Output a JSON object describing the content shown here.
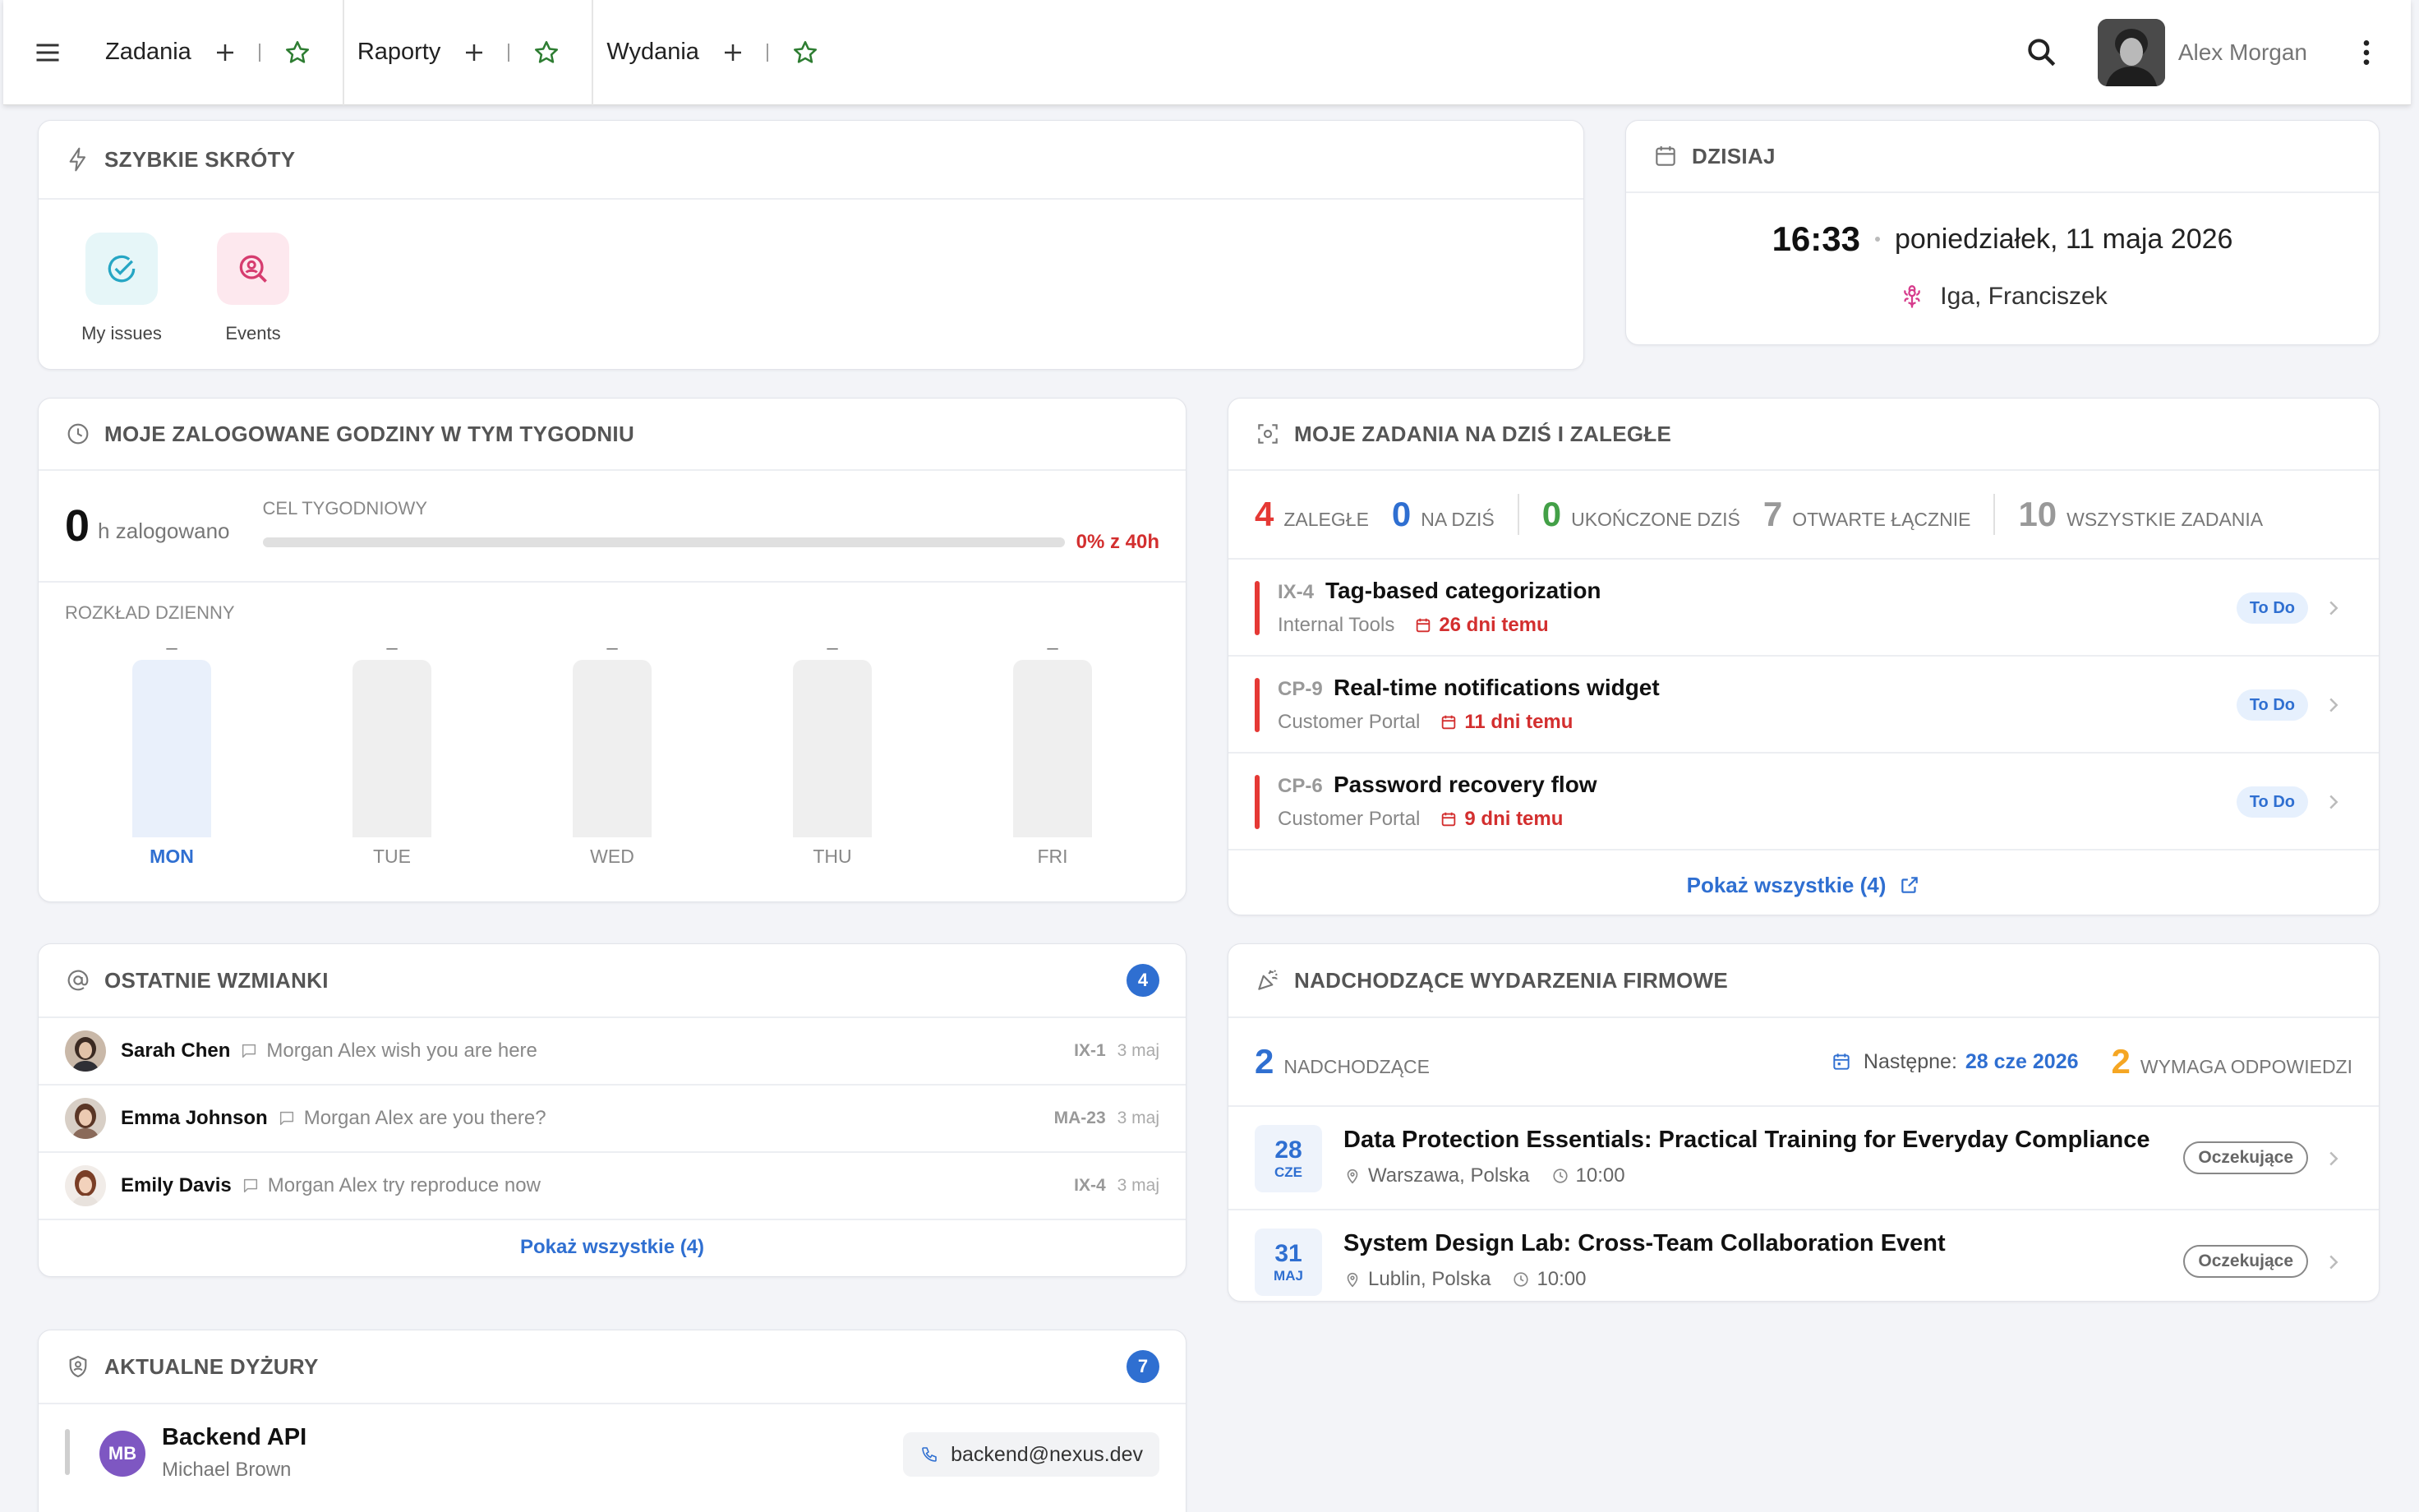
{
  "topbar": {
    "tabs": [
      {
        "label": "Zadania"
      },
      {
        "label": "Raporty"
      },
      {
        "label": "Wydania"
      }
    ],
    "user_name": "Alex Morgan"
  },
  "shortcuts": {
    "title": "SZYBKIE SKRÓTY",
    "items": [
      {
        "label": "My issues",
        "icon": "check-circle-icon",
        "bg": "#e6f6f8",
        "color": "#26a6c4"
      },
      {
        "label": "Events",
        "icon": "search-person-icon",
        "bg": "#fde8ee",
        "color": "#d63c6f"
      }
    ]
  },
  "today": {
    "title": "DZISIAJ",
    "time": "16:33",
    "date": "poniedziałek, 11 maja 2026",
    "nameday": "Iga, Franciszek"
  },
  "hours": {
    "title": "MOJE ZALOGOWANE GODZINY W TYM TYGODNIU",
    "logged": "0",
    "logged_unit": "h zalogowano",
    "goal_label": "CEL TYGODNIOWY",
    "goal_pct_text": "0% z 40h",
    "goal_fraction": 0,
    "daily_label": "ROZKŁAD DZIENNY",
    "days": [
      {
        "day": "MON",
        "value": "–",
        "active": true
      },
      {
        "day": "TUE",
        "value": "–",
        "active": false
      },
      {
        "day": "WED",
        "value": "–",
        "active": false
      },
      {
        "day": "THU",
        "value": "–",
        "active": false
      },
      {
        "day": "FRI",
        "value": "–",
        "active": false
      }
    ]
  },
  "tasks": {
    "title": "MOJE ZADANIA NA DZIŚ I ZALEGŁE",
    "stats": [
      {
        "num": "4",
        "label": "ZALEGŁE",
        "color": "#e53935"
      },
      {
        "num": "0",
        "label": "NA DZIŚ",
        "color": "#2f6fd1"
      },
      {
        "num": "0",
        "label": "UKOŃCZONE DZIŚ",
        "color": "#43a047"
      },
      {
        "num": "7",
        "label": "OTWARTE ŁĄCZNIE",
        "color": "#999999"
      },
      {
        "num": "10",
        "label": "WSZYSTKIE ZADANIA",
        "color": "#999999"
      }
    ],
    "items": [
      {
        "key": "IX-4",
        "title": "Tag-based categorization",
        "project": "Internal Tools",
        "due": "26 dni temu",
        "status": "To Do"
      },
      {
        "key": "CP-9",
        "title": "Real-time notifications widget",
        "project": "Customer Portal",
        "due": "11 dni temu",
        "status": "To Do"
      },
      {
        "key": "CP-6",
        "title": "Password recovery flow",
        "project": "Customer Portal",
        "due": "9 dni temu",
        "status": "To Do"
      }
    ],
    "show_all": "Pokaż wszystkie (4)"
  },
  "mentions": {
    "title": "OSTATNIE WZMIANKI",
    "count": "4",
    "items": [
      {
        "name": "Sarah Chen",
        "text": "Morgan Alex wish you are here",
        "key": "IX-1",
        "date": "3 maj"
      },
      {
        "name": "Emma Johnson",
        "text": "Morgan Alex are you there?",
        "key": "MA-23",
        "date": "3 maj"
      },
      {
        "name": "Emily Davis",
        "text": "Morgan Alex try reproduce now",
        "key": "IX-4",
        "date": "3 maj"
      }
    ],
    "show_all": "Pokaż wszystkie (4)"
  },
  "events": {
    "title": "NADCHODZĄCE WYDARZENIA FIRMOWE",
    "upcoming_num": "2",
    "upcoming_label": "NADCHODZĄCE",
    "next_label": "Następne:",
    "next_date": "28 cze 2026",
    "reply_num": "2",
    "reply_label": "WYMAGA ODPOWIEDZI",
    "items": [
      {
        "day": "28",
        "month": "CZE",
        "title": "Data Protection Essentials: Practical Training for Everyday Compliance",
        "location": "Warszawa, Polska",
        "time": "10:00",
        "status": "Oczekujące"
      },
      {
        "day": "31",
        "month": "MAJ",
        "title": "System Design Lab: Cross-Team Collaboration Event",
        "location": "Lublin, Polska",
        "time": "10:00",
        "status": "Oczekujące"
      }
    ]
  },
  "oncall": {
    "title": "AKTUALNE DYŻURY",
    "count": "7",
    "items": [
      {
        "initials": "MB",
        "team": "Backend API",
        "person": "Michael Brown",
        "contact": "backend@nexus.dev"
      }
    ]
  }
}
